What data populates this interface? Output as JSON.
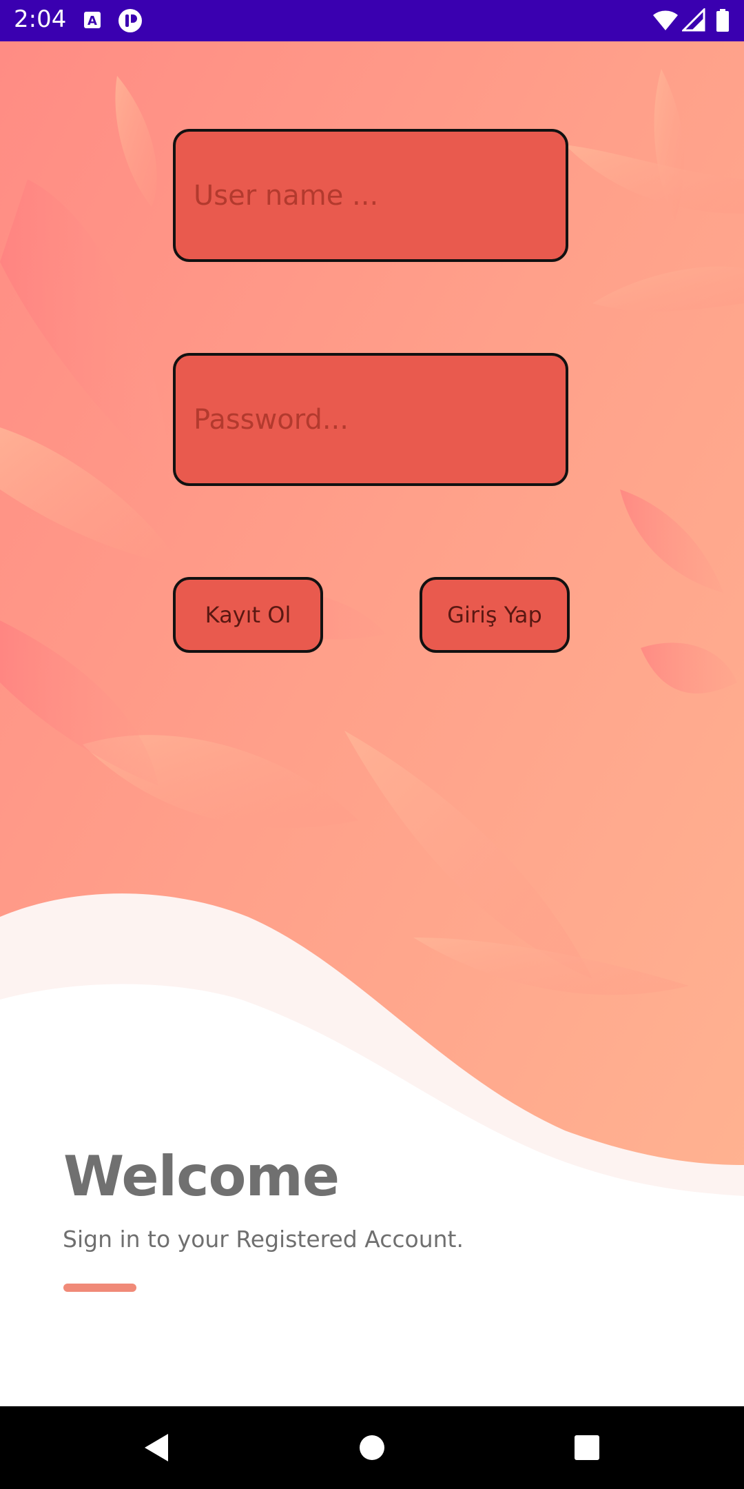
{
  "status_bar": {
    "time": "2:04",
    "background": "#3a00b0",
    "icons": [
      "notification-a-icon",
      "app-badge-icon",
      "wifi-icon",
      "signal-icon",
      "battery-icon"
    ]
  },
  "login_form": {
    "username_placeholder": "User name ...",
    "password_placeholder": "Password...",
    "register_label": "Kayıt Ol",
    "login_label": "Giriş Yap",
    "field_color": "#e95a4e",
    "border_color": "#111111"
  },
  "welcome": {
    "title": "Welcome",
    "subtitle": "Sign in to your Registered Account.",
    "accent_color": "#f08a78"
  },
  "nav_bar": {
    "icons": [
      "back-icon",
      "home-icon",
      "recents-icon"
    ]
  }
}
